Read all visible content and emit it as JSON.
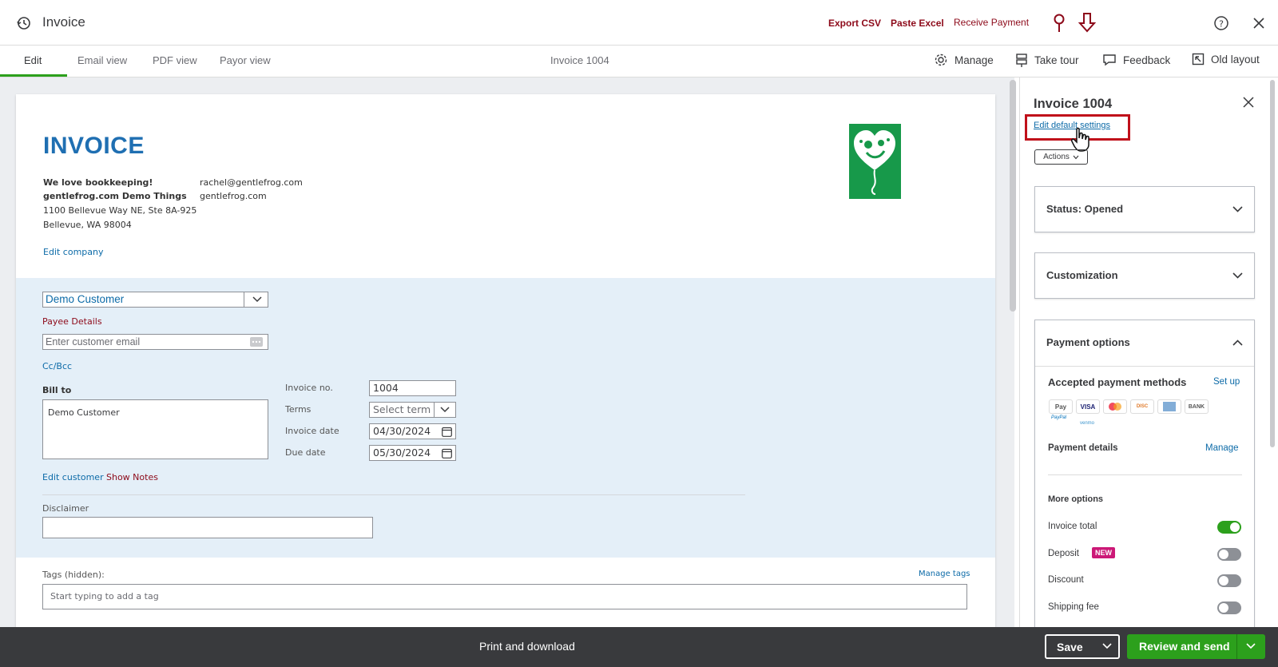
{
  "topbar": {
    "title": "Invoice",
    "export_csv": "Export CSV",
    "paste_excel": "Paste Excel",
    "receive_payment": "Receive Payment"
  },
  "tabs": {
    "items": [
      "Edit",
      "Email view",
      "PDF view",
      "Payor view"
    ],
    "active": "Edit",
    "doc_title": "Invoice 1004"
  },
  "tools": {
    "manage": "Manage",
    "take_tour": "Take tour",
    "feedback": "Feedback",
    "old_layout": "Old layout"
  },
  "invoice": {
    "heading": "INVOICE",
    "company": {
      "line1": "We love bookkeeping!",
      "line2": "gentlefrog.com Demo Things",
      "line3": "1100 Bellevue Way NE, Ste 8A-925",
      "line4": "Bellevue, WA 98004",
      "email": "rachel@gentlefrog.com",
      "website": "gentlefrog.com",
      "edit_link": "Edit company"
    },
    "customer": {
      "name": "Demo Customer",
      "payee_details": "Payee Details",
      "email_placeholder": "Enter customer email",
      "ccbcc": "Cc/Bcc",
      "bill_to_label": "Bill to",
      "bill_to_value": "Demo Customer",
      "edit_customer": "Edit customer",
      "show_notes": "Show Notes"
    },
    "fields": {
      "invoice_no_label": "Invoice no.",
      "invoice_no": "1004",
      "terms_label": "Terms",
      "terms_placeholder": "Select term",
      "invoice_date_label": "Invoice date",
      "invoice_date": "04/30/2024",
      "due_date_label": "Due date",
      "due_date": "05/30/2024"
    },
    "disclaimer_label": "Disclaimer",
    "tags_label": "Tags (hidden):",
    "manage_tags": "Manage tags",
    "tags_placeholder": "Start typing to add a tag"
  },
  "panel": {
    "title": "Invoice 1004",
    "edit_default_settings": "Edit default settings",
    "actions": "Actions",
    "status": "Status: Opened",
    "customization": "Customization",
    "payment_options": "Payment options",
    "accepted_methods": "Accepted payment methods",
    "set_up": "Set up",
    "payment_icons": [
      "Pay",
      "VISA",
      "MC",
      "DISC",
      "AMEX",
      "BANK"
    ],
    "paypal_text": "PayPal",
    "venmo_text": "venmo",
    "payment_details": "Payment details",
    "manage": "Manage",
    "more_options": "More options",
    "options": [
      {
        "label": "Invoice total",
        "on": true
      },
      {
        "label": "Deposit",
        "on": false,
        "badge": "NEW"
      },
      {
        "label": "Discount",
        "on": false
      },
      {
        "label": "Shipping fee",
        "on": false
      }
    ]
  },
  "bottombar": {
    "print": "Print and download",
    "save": "Save",
    "review_send": "Review and send"
  },
  "colors": {
    "accent_green": "#2ca01c",
    "brand_red": "#8d0a1a",
    "link_blue": "#0d6ba8",
    "heading_blue": "#1f6fb2",
    "highlight_red": "#c0101a"
  }
}
